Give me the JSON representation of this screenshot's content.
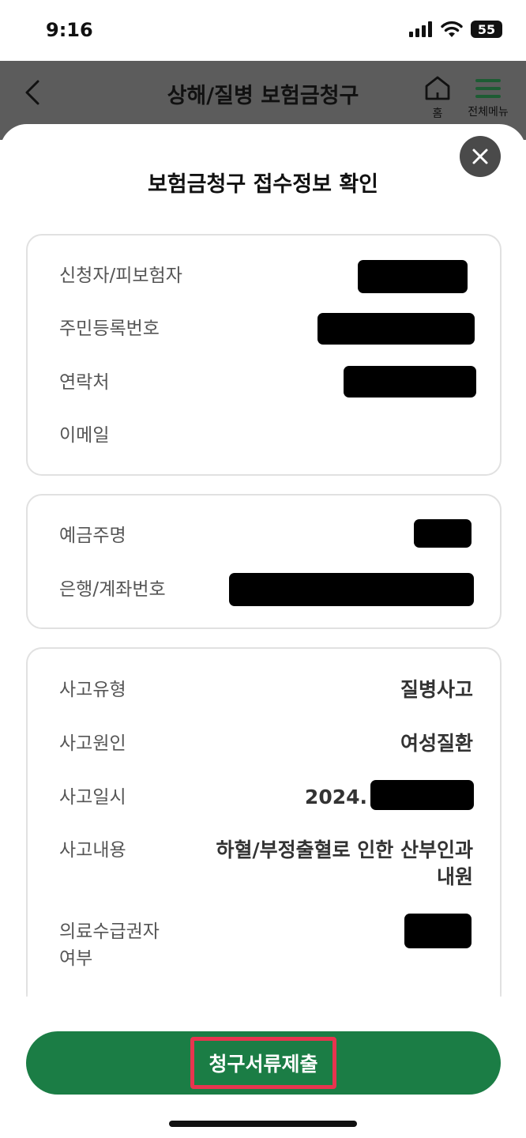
{
  "status_bar": {
    "time": "9:16",
    "battery": "55"
  },
  "header": {
    "title": "상해/질병 보험금청구",
    "home_label": "홈",
    "menu_label": "전체메뉴"
  },
  "sheet": {
    "title": "보험금청구 접수정보 확인"
  },
  "applicant": {
    "name_label": "신청자/피보험자",
    "rrn_label": "주민등록번호",
    "phone_label": "연락처",
    "email_label": "이메일"
  },
  "bank": {
    "holder_label": "예금주명",
    "account_label": "은행/계좌번호"
  },
  "accident": {
    "type_label": "사고유형",
    "type_value": "질병사고",
    "cause_label": "사고원인",
    "cause_value": "여성질환",
    "date_label": "사고일시",
    "date_value": "2024.",
    "content_label": "사고내용",
    "content_value_line1": "하혈/부정출혈로 인한 산부인과",
    "content_value_line2": "내원",
    "medical_label_line1": "의료수급권자",
    "medical_label_line2": "여부"
  },
  "footer": {
    "submit_label": "청구서류제출"
  },
  "colors": {
    "brand_green": "#1b7d45",
    "highlight_red": "#e8344f",
    "overlay_gray": "#5c5c5c"
  },
  "icons": [
    "signal-icon",
    "wifi-icon",
    "battery-icon",
    "back-icon",
    "home-icon",
    "hamburger-menu-icon",
    "close-icon"
  ]
}
